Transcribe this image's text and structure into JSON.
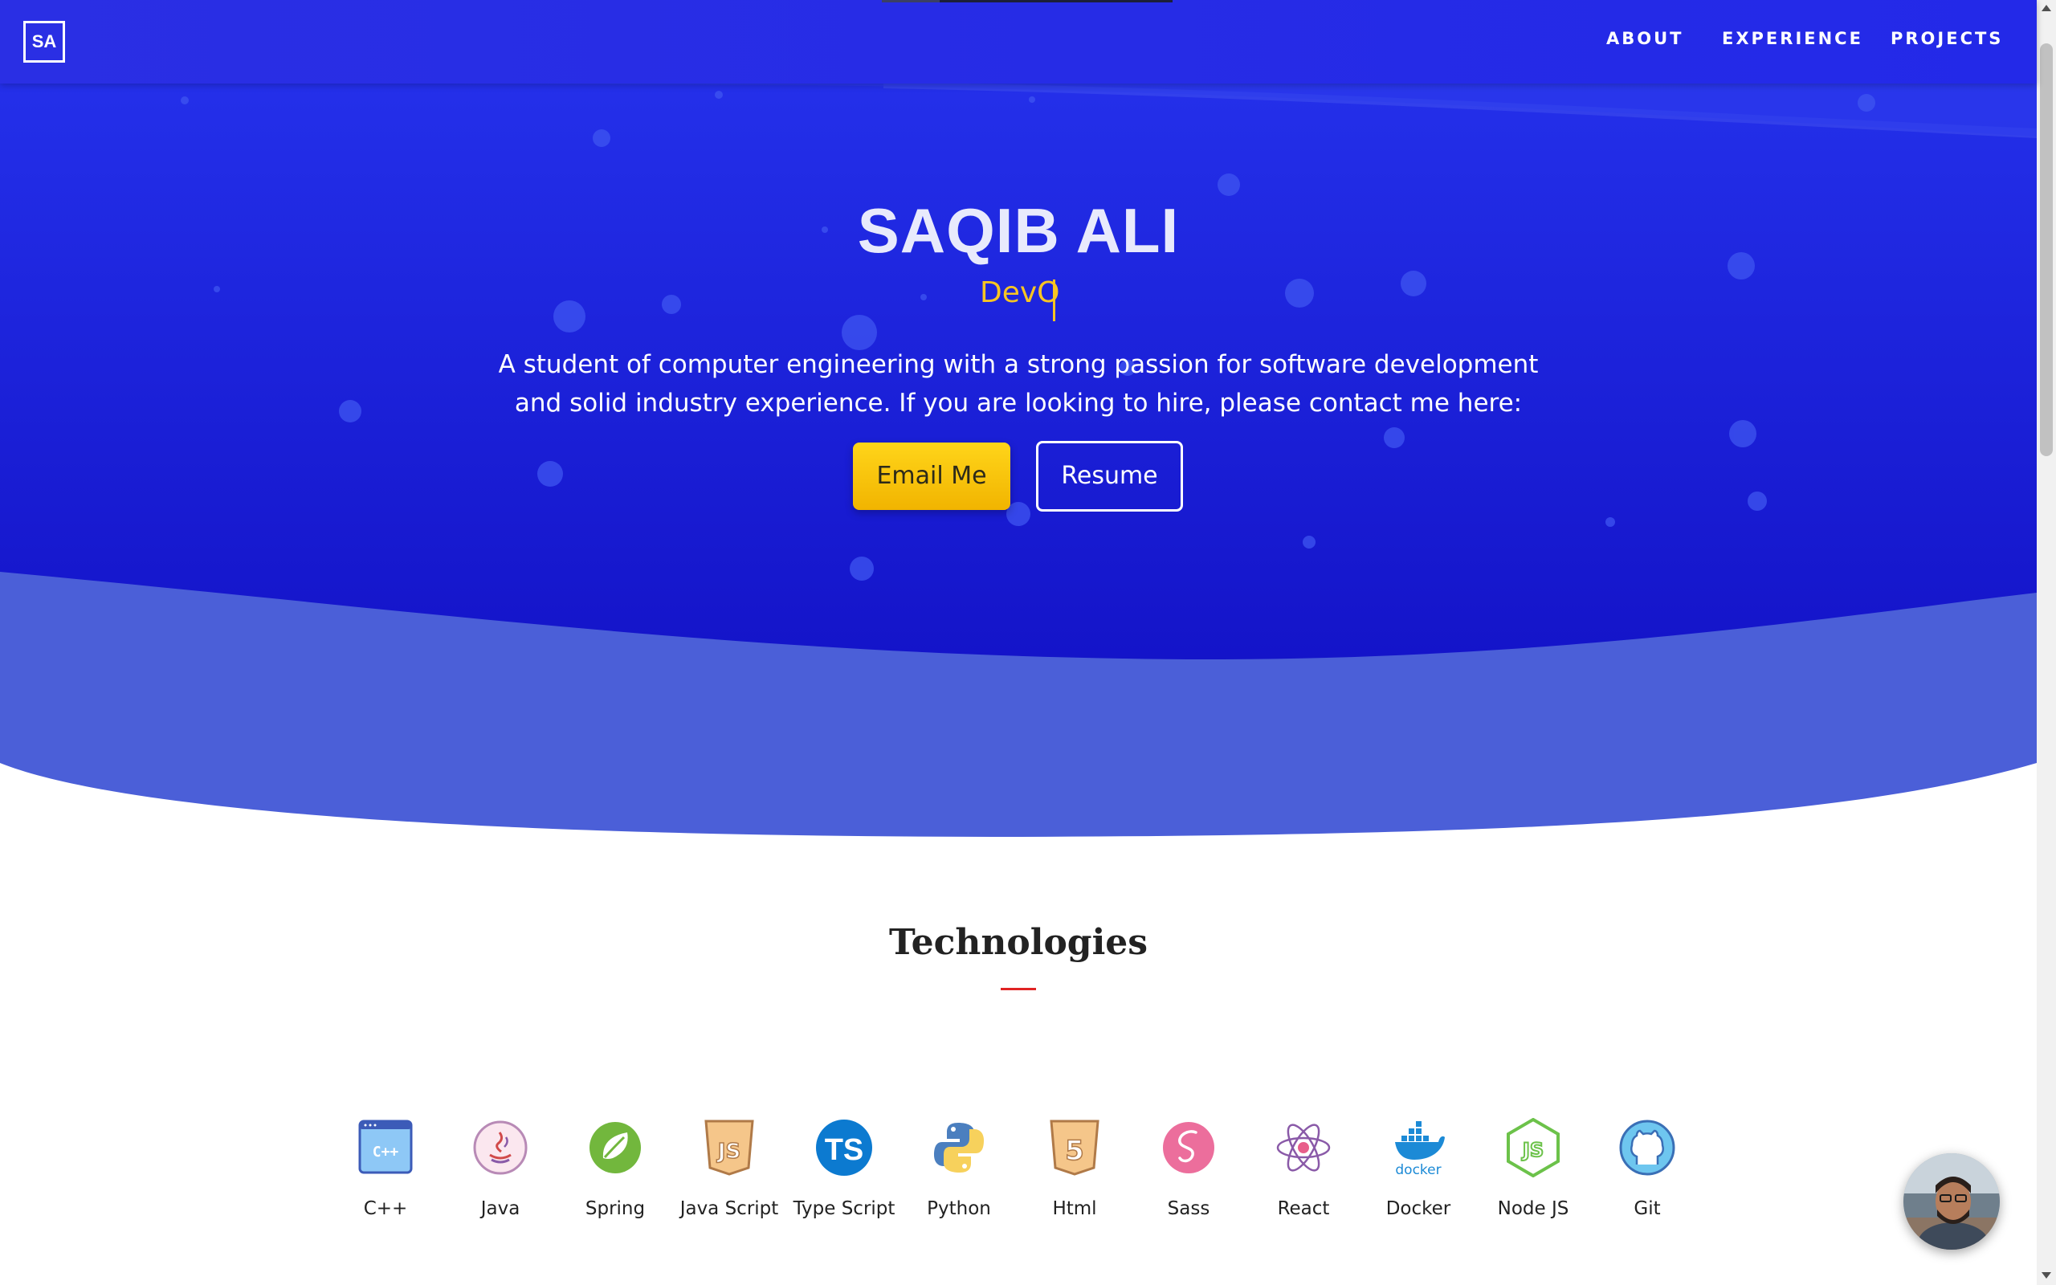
{
  "nav": {
    "logo": "SA",
    "links": [
      "ABOUT",
      "EXPERIENCE",
      "PROJECTS"
    ]
  },
  "hero": {
    "name": "SAQIB ALI",
    "typed_text": "DevO",
    "description": "A student of computer engineering with a strong passion for software development and solid industry experience. If you are looking to hire, please contact me here:",
    "email_button": "Email Me",
    "resume_button": "Resume"
  },
  "technologies": {
    "title": "Technologies",
    "items": [
      {
        "label": "C++",
        "icon": "cplusplus-icon"
      },
      {
        "label": "Java",
        "icon": "java-icon"
      },
      {
        "label": "Spring",
        "icon": "spring-icon"
      },
      {
        "label": "Java Script",
        "icon": "javascript-icon"
      },
      {
        "label": "Type Script",
        "icon": "typescript-icon"
      },
      {
        "label": "Python",
        "icon": "python-icon"
      },
      {
        "label": "Html",
        "icon": "html5-icon"
      },
      {
        "label": "Sass",
        "icon": "sass-icon"
      },
      {
        "label": "React",
        "icon": "react-icon"
      },
      {
        "label": "Docker",
        "icon": "docker-icon"
      },
      {
        "label": "Node JS",
        "icon": "nodejs-icon"
      },
      {
        "label": "Git",
        "icon": "github-icon"
      }
    ]
  },
  "colors": {
    "hero_blue": "#1f24df",
    "wave_blue": "#4b5fd8",
    "accent_yellow": "#f7c523",
    "underline_red": "#e02424"
  }
}
